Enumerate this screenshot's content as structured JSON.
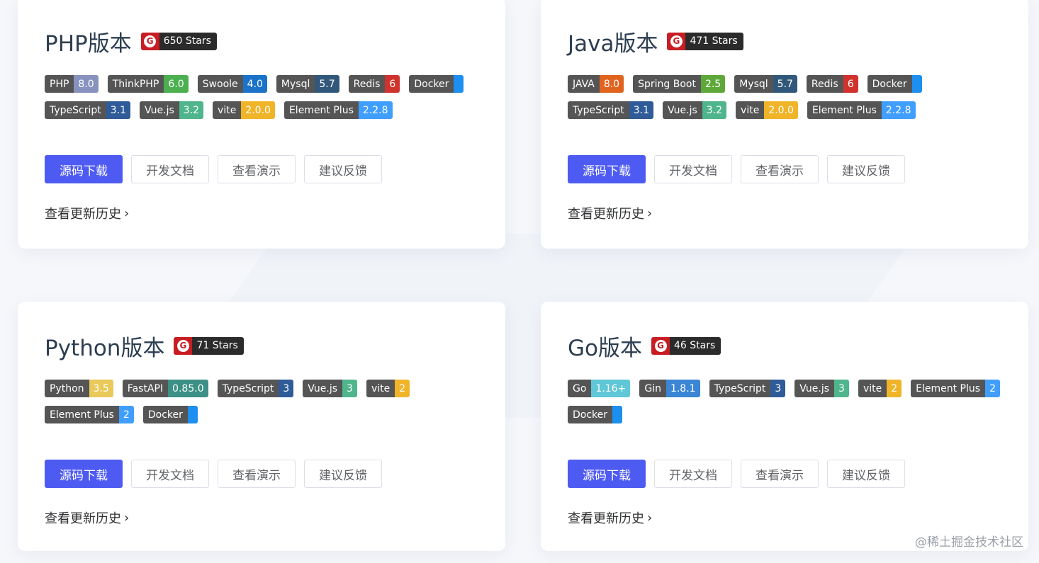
{
  "cards": [
    {
      "title": "PHP版本",
      "stars": "650 Stars",
      "badges": [
        {
          "k": "PHP",
          "v": "8.0",
          "color": "#8892bf"
        },
        {
          "k": "ThinkPHP",
          "v": "6.0",
          "color": "#4caf50"
        },
        {
          "k": "Swoole",
          "v": "4.0",
          "color": "#1a73c8"
        },
        {
          "k": "Mysql",
          "v": "5.7",
          "color": "#31587a"
        },
        {
          "k": "Redis",
          "v": "6",
          "color": "#d0322d"
        },
        {
          "k": "Docker",
          "v": "",
          "color": "#1d8ff0"
        },
        {
          "k": "TypeScript",
          "v": "3.1",
          "color": "#2f5b98"
        },
        {
          "k": "Vue.js",
          "v": "3.2",
          "color": "#4fb58c"
        },
        {
          "k": "vite",
          "v": "2.0.0",
          "color": "#f0b429"
        },
        {
          "k": "Element Plus",
          "v": "2.2.8",
          "color": "#409eff"
        }
      ]
    },
    {
      "title": "Java版本",
      "stars": "471 Stars",
      "badges": [
        {
          "k": "JAVA",
          "v": "8.0",
          "color": "#e0631e"
        },
        {
          "k": "Spring Boot",
          "v": "2.5",
          "color": "#5ea839"
        },
        {
          "k": "Mysql",
          "v": "5.7",
          "color": "#31587a"
        },
        {
          "k": "Redis",
          "v": "6",
          "color": "#d0322d"
        },
        {
          "k": "Docker",
          "v": "",
          "color": "#1d8ff0"
        },
        {
          "k": "TypeScript",
          "v": "3.1",
          "color": "#2f5b98"
        },
        {
          "k": "Vue.js",
          "v": "3.2",
          "color": "#4fb58c"
        },
        {
          "k": "vite",
          "v": "2.0.0",
          "color": "#f0b429"
        },
        {
          "k": "Element Plus",
          "v": "2.2.8",
          "color": "#409eff"
        }
      ]
    },
    {
      "title": "Python版本",
      "stars": "71 Stars",
      "badges": [
        {
          "k": "Python",
          "v": "3.5",
          "color": "#e8c95a"
        },
        {
          "k": "FastAPI",
          "v": "0.85.0",
          "color": "#3c9085"
        },
        {
          "k": "TypeScript",
          "v": "3",
          "color": "#2f5b98"
        },
        {
          "k": "Vue.js",
          "v": "3",
          "color": "#4fb58c"
        },
        {
          "k": "vite",
          "v": "2",
          "color": "#f0b429"
        },
        {
          "k": "Element Plus",
          "v": "2",
          "color": "#409eff"
        },
        {
          "k": "Docker",
          "v": "",
          "color": "#1d8ff0"
        }
      ]
    },
    {
      "title": "Go版本",
      "stars": "46 Stars",
      "badges": [
        {
          "k": "Go",
          "v": "1.16+",
          "color": "#5fc7d6"
        },
        {
          "k": "Gin",
          "v": "1.8.1",
          "color": "#3b86d4"
        },
        {
          "k": "TypeScript",
          "v": "3",
          "color": "#2f5b98"
        },
        {
          "k": "Vue.js",
          "v": "3",
          "color": "#4fb58c"
        },
        {
          "k": "vite",
          "v": "2",
          "color": "#f0b429"
        },
        {
          "k": "Element Plus",
          "v": "2",
          "color": "#409eff"
        },
        {
          "k": "Docker",
          "v": "",
          "color": "#1d8ff0"
        }
      ]
    }
  ],
  "buttons": {
    "download": "源码下载",
    "docs": "开发文档",
    "demo": "查看演示",
    "feedback": "建议反馈"
  },
  "history_link": "查看更新历史",
  "gitee_icon": "gitee-logo-icon",
  "watermark": "@稀土掘金技术社区"
}
